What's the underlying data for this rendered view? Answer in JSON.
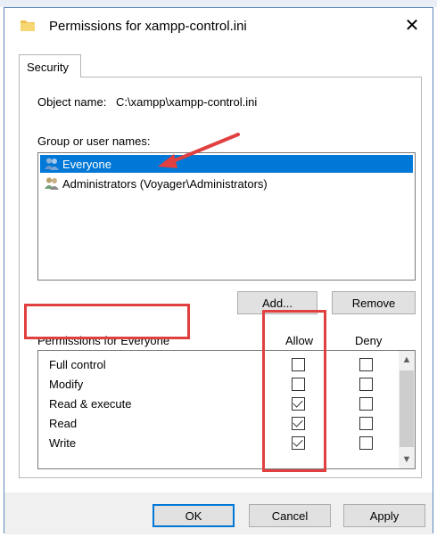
{
  "window": {
    "title": "Permissions for xampp-control.ini",
    "close_glyph": "✕"
  },
  "tabs": [
    {
      "label": "Security"
    }
  ],
  "object": {
    "label": "Object name:",
    "value": "C:\\xampp\\xampp-control.ini"
  },
  "groups": {
    "label": "Group or user names:",
    "items": [
      {
        "label": "Everyone",
        "selected": true
      },
      {
        "label": "Administrators (Voyager\\Administrators)",
        "selected": false
      }
    ],
    "add_label": "Add...",
    "remove_label": "Remove"
  },
  "permissions": {
    "header": "Permissions for Everyone",
    "allow_label": "Allow",
    "deny_label": "Deny",
    "rows": [
      {
        "label": "Full control",
        "allow": false,
        "deny": false
      },
      {
        "label": "Modify",
        "allow": false,
        "deny": false
      },
      {
        "label": "Read & execute",
        "allow": true,
        "deny": false
      },
      {
        "label": "Read",
        "allow": true,
        "deny": false
      },
      {
        "label": "Write",
        "allow": true,
        "deny": false
      }
    ]
  },
  "footer": {
    "ok_label": "OK",
    "cancel_label": "Cancel",
    "apply_label": "Apply"
  },
  "colors": {
    "selection": "#0078d7",
    "annotation": "#e0403f",
    "folder": "#f0c250"
  }
}
